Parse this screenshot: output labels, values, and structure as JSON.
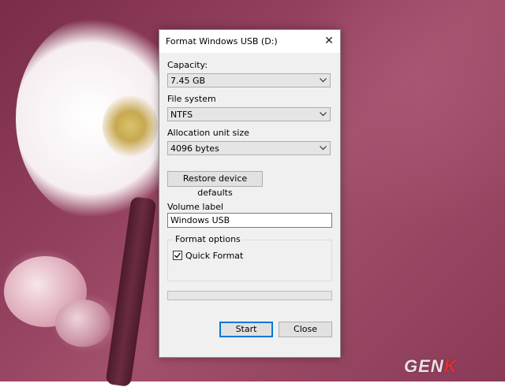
{
  "dialog": {
    "title": "Format Windows USB (D:)",
    "capacity": {
      "label": "Capacity:",
      "value": "7.45 GB"
    },
    "file_system": {
      "label": "File system",
      "value": "NTFS"
    },
    "allocation_unit": {
      "label": "Allocation unit size",
      "value": "4096 bytes"
    },
    "restore_defaults_label": "Restore device defaults",
    "volume_label": {
      "label": "Volume label",
      "value": "Windows USB"
    },
    "format_options": {
      "legend": "Format options",
      "quick_format": {
        "label": "Quick Format",
        "checked": true
      }
    },
    "progress": {
      "value": 0
    },
    "start_label": "Start",
    "close_label": "Close"
  },
  "watermark": {
    "logo_text": "GENK"
  },
  "colors": {
    "accent": "#0078d7",
    "dialog_bg": "#f0f0f0",
    "button_bg": "#e1e1e1"
  }
}
